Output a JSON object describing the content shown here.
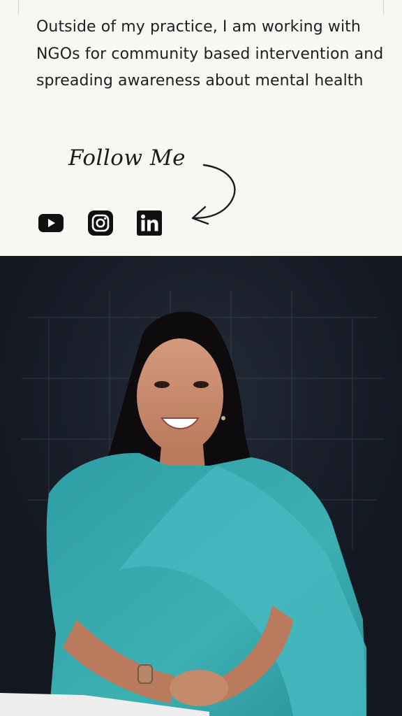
{
  "about": {
    "bio": "Outside of my practice, I am working with NGOs for community based intervention and spreading awareness about mental health"
  },
  "follow": {
    "heading": "Follow Me"
  },
  "social": [
    {
      "icon": "youtube-icon"
    },
    {
      "icon": "instagram-icon"
    },
    {
      "icon": "linkedin-icon"
    }
  ],
  "colors": {
    "page_background": "#f8f7f3",
    "text": "#1f1f1f",
    "photo_background": "#141a26",
    "saree": "#35a6aa"
  }
}
